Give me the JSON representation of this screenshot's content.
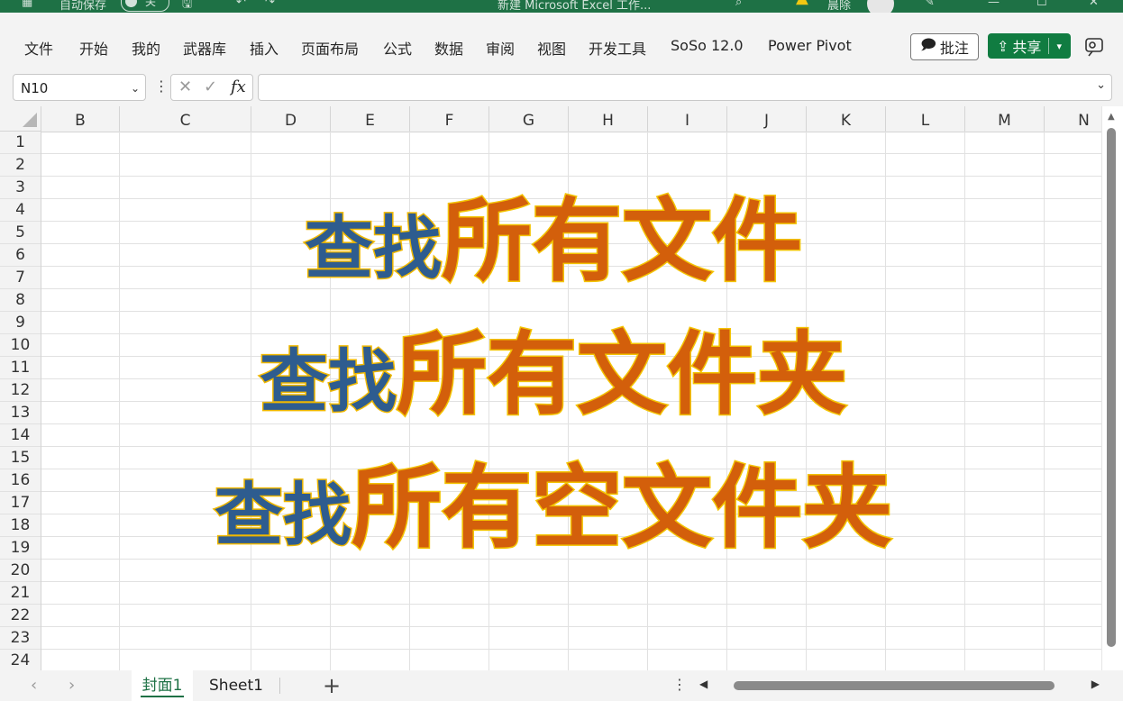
{
  "titlebar": {
    "autosave_label": "自动保存",
    "autosave_state": "关",
    "file_name": "新建 Microsoft Excel 工作...",
    "user_name": "晨除"
  },
  "menu": {
    "items": [
      "文件",
      "开始",
      "我的",
      "武器库",
      "插入",
      "页面布局",
      "公式",
      "数据",
      "审阅",
      "视图",
      "开发工具",
      "SoSo 12.0",
      "Power Pivot"
    ],
    "comment_label": "批注",
    "share_label": "共享"
  },
  "formula_bar": {
    "name_box": "N10",
    "fx_label": "fx",
    "formula": ""
  },
  "columns": [
    "B",
    "C",
    "D",
    "E",
    "F",
    "G",
    "H",
    "I",
    "J",
    "K",
    "L",
    "M",
    "N"
  ],
  "rows": [
    "1",
    "2",
    "3",
    "4",
    "5",
    "6",
    "7",
    "8",
    "9",
    "10",
    "11",
    "12",
    "13",
    "14",
    "15",
    "16",
    "17",
    "18",
    "19",
    "20",
    "21",
    "22",
    "23",
    "24"
  ],
  "headlines": [
    {
      "blue": "查找",
      "orange": "所有文件"
    },
    {
      "blue": "查找",
      "orange": "所有文件夹"
    },
    {
      "blue": "查找",
      "orange": "所有空文件夹"
    }
  ],
  "sheets": {
    "active": "封面1",
    "other": "Sheet1",
    "add_label": "+"
  },
  "colors": {
    "excel_green": "#1e7145",
    "headline_blue": "#2e5c8f",
    "headline_orange": "#d35f0b",
    "headline_outline": "#f3c300"
  }
}
